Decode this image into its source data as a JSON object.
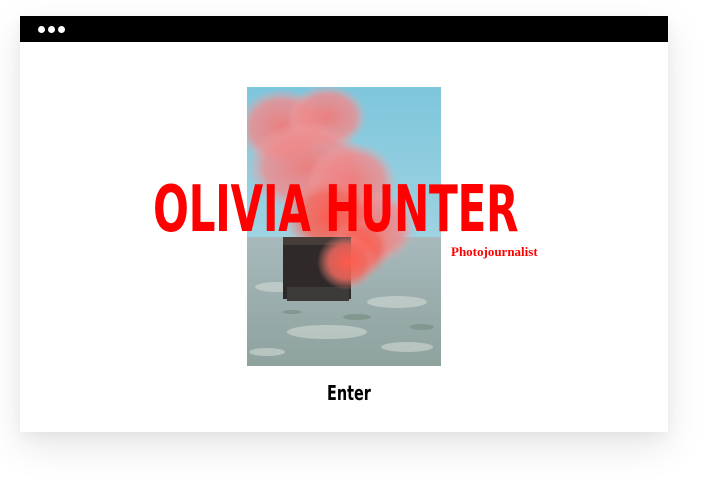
{
  "window": {
    "titlebar_color": "#000000",
    "controls": [
      "dot-icon",
      "dot-icon",
      "dot-icon"
    ]
  },
  "hero": {
    "name": "OLIVIA HUNTER",
    "role": "Photojournalist",
    "accent_color": "#ff0000",
    "photo_subject": "smoke-over-box-photo"
  },
  "nav": {
    "enter_label": "Enter"
  }
}
